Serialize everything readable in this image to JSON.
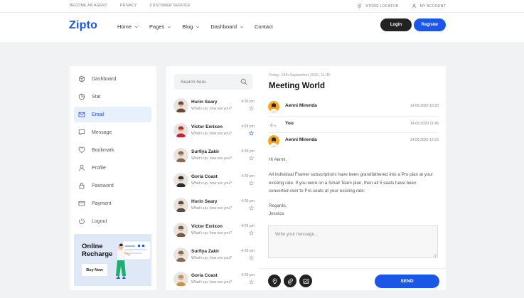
{
  "topbar": {
    "left_links": [
      "BECOME AN AGENT",
      "PRIVACY",
      "CUSTOMER SERVICE"
    ],
    "store_locator": "STORE LOCATOR",
    "my_account": "MY ACCOUNT"
  },
  "header": {
    "logo": "Zipto",
    "nav": [
      "Home",
      "Pages",
      "Blog",
      "Dashboard",
      "Contact"
    ],
    "login_label": "Login",
    "register_label": "Register"
  },
  "sidebar": {
    "items": [
      {
        "label": "Dashboard",
        "icon": "cube-icon"
      },
      {
        "label": "Stat",
        "icon": "pie-chart-icon"
      },
      {
        "label": "Email",
        "icon": "mail-icon",
        "active": true
      },
      {
        "label": "Message",
        "icon": "chat-icon"
      },
      {
        "label": "Bookmark",
        "icon": "heart-icon"
      },
      {
        "label": "Profile",
        "icon": "user-icon"
      },
      {
        "label": "Password",
        "icon": "lock-icon"
      },
      {
        "label": "Payment",
        "icon": "credit-card-icon"
      },
      {
        "label": "Logout",
        "icon": "power-icon"
      }
    ],
    "promo": {
      "title_line1": "Online",
      "title_line2": "Recharge",
      "button": "Buy Now"
    }
  },
  "contacts": {
    "search_placeholder": "Search here.",
    "items": [
      {
        "name": "Hurin Seary",
        "message": "What's up, how are you?",
        "time": "4:09 pm",
        "starred": false,
        "avatar_color": "#6b4a35"
      },
      {
        "name": "Victor Exrixon",
        "message": "What's up, how are you?",
        "time": "4:09 pm",
        "starred": true,
        "avatar_color": "#c0262b"
      },
      {
        "name": "Surfiya Zakir",
        "message": "What's up, how are you?",
        "time": "4:09 pm",
        "starred": false,
        "avatar_color": "#8a6b52"
      },
      {
        "name": "Goria Coast",
        "message": "What's up, how are you?",
        "time": "4:09 pm",
        "starred": false,
        "avatar_color": "#2c2c2c"
      },
      {
        "name": "Hurin Seary",
        "message": "What's up, how are you?",
        "time": "4:09 pm",
        "starred": false,
        "avatar_color": "#5a4a40"
      },
      {
        "name": "Victor Exrixon",
        "message": "What's up, how are you?",
        "time": "4:09 pm",
        "starred": false,
        "avatar_color": "#7a5a48"
      },
      {
        "name": "Surfiya Zakir",
        "message": "What's up, how are you?",
        "time": "4:09 pm",
        "starred": false,
        "avatar_color": "#8a6b52"
      },
      {
        "name": "Goria Coast",
        "message": "What's up, how are you?",
        "time": "4:09 pm",
        "starred": false,
        "avatar_color": "#c9924a"
      }
    ]
  },
  "message": {
    "date": "Today, 16th September 2020, 11:45",
    "subject": "Meeting World",
    "thread": [
      {
        "name": "Aenni Mirenda",
        "time": "14.09.2020 10:23",
        "type": "avatar"
      },
      {
        "name": "You",
        "time": "14.09.2020 11:45",
        "type": "reply"
      },
      {
        "name": "Aenni Mirenda",
        "time": "14.09.2020 12:23",
        "type": "avatar"
      }
    ],
    "greeting": "Hi Aenni,",
    "paragraph_lines": [
      "All individual Framer subscriptions have been grandfathered into a Pro plan at your",
      "existing rate. If you were on a Small Team plan, then all 5 seats have been",
      "converted over to Pro seats at your existing rate."
    ],
    "closing": "Regards,",
    "signature": "Jessica",
    "reply_placeholder": "Write your message...",
    "send_label": "SEND"
  },
  "colors": {
    "accent": "#1a56e8",
    "dark": "#222222",
    "background": "#f1f2f4",
    "active_bg": "#e8effd"
  }
}
